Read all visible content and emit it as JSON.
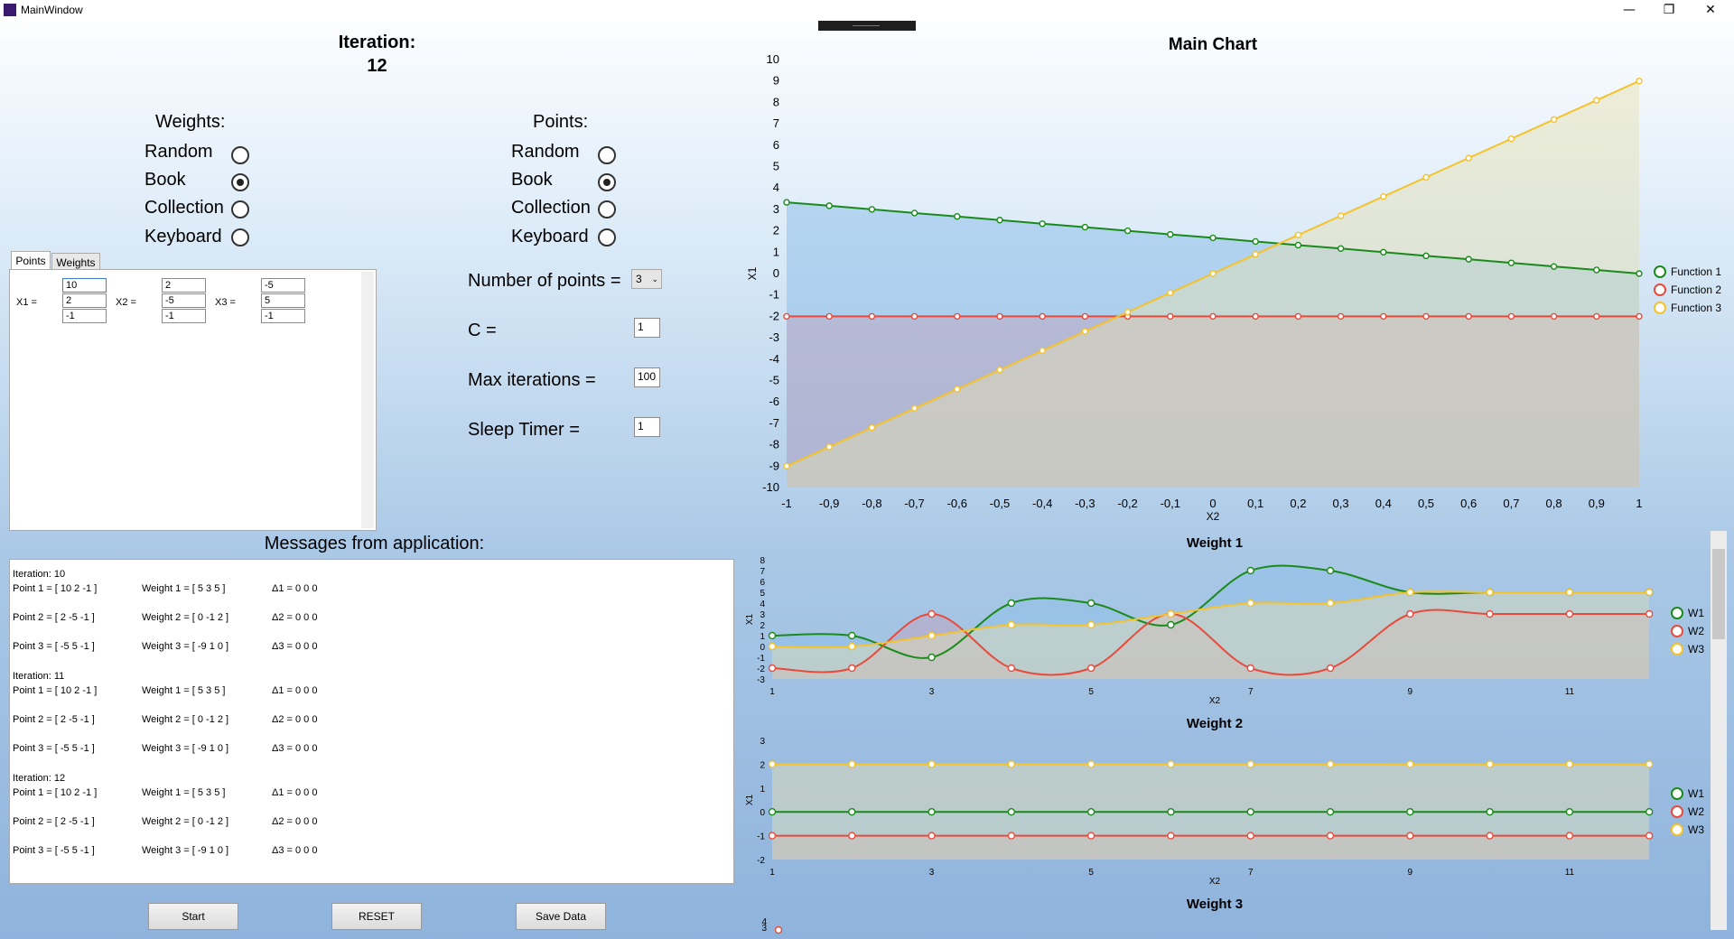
{
  "window": {
    "title": "MainWindow",
    "minimize": "—",
    "restore": "❐",
    "close": "✕"
  },
  "iteration": {
    "label": "Iteration:",
    "value": "12"
  },
  "weights_group": {
    "title": "Weights:",
    "options": [
      "Random",
      "Book",
      "Collection",
      "Keyboard"
    ],
    "selected": "Book"
  },
  "points_group": {
    "title": "Points:",
    "options": [
      "Random",
      "Book",
      "Collection",
      "Keyboard"
    ],
    "selected": "Book"
  },
  "tabs": [
    "Points",
    "Weights"
  ],
  "active_tab": "Points",
  "point_inputs": {
    "x1_label": "X1 =",
    "x2_label": "X2 =",
    "x3_label": "X3 =",
    "x1": [
      "10",
      "2",
      "-1"
    ],
    "x2": [
      "2",
      "-5",
      "-1"
    ],
    "x3": [
      "-5",
      "5",
      "-1"
    ]
  },
  "settings": {
    "num_points_label": "Number of points =",
    "num_points_value": "3",
    "c_label": "C =",
    "c_value": "1",
    "max_iter_label": "Max iterations =",
    "max_iter_value": "100",
    "sleep_label": "Sleep Timer =",
    "sleep_value": "1"
  },
  "messages_title": "Messages from application:",
  "messages": [
    {
      "iteration": "Iteration: 10",
      "rows": [
        [
          "Point 1 = [ 10 2 -1 ]",
          "Weight 1 = [ 5 3 5 ]",
          "Δ1 = 0 0 0"
        ],
        [
          "Point 2 = [ 2 -5 -1 ]",
          "Weight 2 = [ 0 -1 2 ]",
          "Δ2 = 0 0 0"
        ],
        [
          "Point 3 = [ -5 5 -1 ]",
          "Weight 3 = [ -9 1 0 ]",
          "Δ3 = 0 0 0"
        ]
      ]
    },
    {
      "iteration": "Iteration: 11",
      "rows": [
        [
          "Point 1 = [ 10 2 -1 ]",
          "Weight 1 = [ 5 3 5 ]",
          "Δ1 = 0 0 0"
        ],
        [
          "Point 2 = [ 2 -5 -1 ]",
          "Weight 2 = [ 0 -1 2 ]",
          "Δ2 = 0 0 0"
        ],
        [
          "Point 3 = [ -5 5 -1 ]",
          "Weight 3 = [ -9 1 0 ]",
          "Δ3 = 0 0 0"
        ]
      ]
    },
    {
      "iteration": "Iteration: 12",
      "rows": [
        [
          "Point 1 = [ 10 2 -1 ]",
          "Weight 1 = [ 5 3 5 ]",
          "Δ1 = 0 0 0"
        ],
        [
          "Point 2 = [ 2 -5 -1 ]",
          "Weight 2 = [ 0 -1 2 ]",
          "Δ2 = 0 0 0"
        ],
        [
          "Point 3 = [ -5 5 -1 ]",
          "Weight 3 = [ -9 1 0 ]",
          "Δ3 = 0 0 0"
        ]
      ]
    }
  ],
  "buttons": {
    "start": "Start",
    "reset": "RESET",
    "save": "Save Data"
  },
  "colors": {
    "green": "#1a8a1a",
    "red": "#e84a3c",
    "yellow": "#f6c229"
  },
  "chart_data": [
    {
      "type": "area",
      "title": "Main Chart",
      "xlabel": "X2",
      "ylabel": "X1",
      "xlim": [
        -1,
        1
      ],
      "ylim": [
        -10,
        10
      ],
      "x_ticks": [
        "-1",
        "-0,9",
        "-0,8",
        "-0,7",
        "-0,6",
        "-0,5",
        "-0,4",
        "-0,3",
        "-0,2",
        "-0,1",
        "0",
        "0,1",
        "0,2",
        "0,3",
        "0,4",
        "0,5",
        "0,6",
        "0,7",
        "0,8",
        "0,9",
        "1"
      ],
      "y_ticks": [
        "10",
        "9",
        "8",
        "7",
        "6",
        "5",
        "4",
        "3",
        "2",
        "1",
        "0",
        "-1",
        "-2",
        "-3",
        "-4",
        "-5",
        "-6",
        "-7",
        "-8",
        "-9",
        "-10"
      ],
      "x": [
        -1,
        -0.9,
        -0.8,
        -0.7,
        -0.6,
        -0.5,
        -0.4,
        -0.3,
        -0.2,
        -0.1,
        0,
        0.1,
        0.2,
        0.3,
        0.4,
        0.5,
        0.6,
        0.7,
        0.8,
        0.9,
        1
      ],
      "legend_position": "right",
      "series": [
        {
          "name": "Function 1",
          "color": "#1a8a1a",
          "values": [
            3.33,
            3.17,
            3.0,
            2.83,
            2.67,
            2.5,
            2.33,
            2.17,
            2.0,
            1.83,
            1.67,
            1.5,
            1.33,
            1.17,
            1.0,
            0.83,
            0.67,
            0.5,
            0.33,
            0.17,
            0
          ]
        },
        {
          "name": "Function 2",
          "color": "#e84a3c",
          "values": [
            -2,
            -2,
            -2,
            -2,
            -2,
            -2,
            -2,
            -2,
            -2,
            -2,
            -2,
            -2,
            -2,
            -2,
            -2,
            -2,
            -2,
            -2,
            -2,
            -2,
            -2
          ]
        },
        {
          "name": "Function 3",
          "color": "#f6c229",
          "values": [
            -9,
            -8.1,
            -7.2,
            -6.3,
            -5.4,
            -4.5,
            -3.6,
            -2.7,
            -1.8,
            -0.9,
            0,
            0.9,
            1.8,
            2.7,
            3.6,
            4.5,
            5.4,
            6.3,
            7.2,
            8.1,
            9
          ]
        }
      ]
    },
    {
      "type": "area",
      "title": "Weight 1",
      "xlabel": "X2",
      "ylabel": "X1",
      "xlim": [
        1,
        12.1
      ],
      "ylim": [
        -3,
        8
      ],
      "x_ticks": [
        "1",
        "3",
        "5",
        "7",
        "9",
        "11"
      ],
      "y_ticks": [
        "8",
        "7",
        "6",
        "5",
        "4",
        "3",
        "2",
        "1",
        "0",
        "-1",
        "-2",
        "-3"
      ],
      "x": [
        1,
        2,
        3,
        4,
        5,
        6,
        7,
        8,
        9,
        10,
        11,
        12
      ],
      "legend_position": "right",
      "series": [
        {
          "name": "W1",
          "color": "#1a8a1a",
          "values": [
            1,
            1,
            -1,
            4,
            4,
            2,
            7,
            7,
            5,
            5,
            5,
            5
          ]
        },
        {
          "name": "W2",
          "color": "#e84a3c",
          "values": [
            -2,
            -2,
            3,
            -2,
            -2,
            3,
            -2,
            -2,
            3,
            3,
            3,
            3
          ]
        },
        {
          "name": "W3",
          "color": "#f6c229",
          "values": [
            0,
            0,
            1,
            2,
            2,
            3,
            4,
            4,
            5,
            5,
            5,
            5
          ]
        }
      ]
    },
    {
      "type": "area",
      "title": "Weight 2",
      "xlabel": "X2",
      "ylabel": "X1",
      "xlim": [
        1,
        12.1
      ],
      "ylim": [
        -2,
        3
      ],
      "x_ticks": [
        "1",
        "3",
        "5",
        "7",
        "9",
        "11"
      ],
      "y_ticks": [
        "3",
        "2",
        "1",
        "0",
        "-1",
        "-2"
      ],
      "x": [
        1,
        2,
        3,
        4,
        5,
        6,
        7,
        8,
        9,
        10,
        11,
        12
      ],
      "legend_position": "right",
      "series": [
        {
          "name": "W1",
          "color": "#1a8a1a",
          "values": [
            0,
            0,
            0,
            0,
            0,
            0,
            0,
            0,
            0,
            0,
            0,
            0
          ]
        },
        {
          "name": "W2",
          "color": "#e84a3c",
          "values": [
            -1,
            -1,
            -1,
            -1,
            -1,
            -1,
            -1,
            -1,
            -1,
            -1,
            -1,
            -1
          ]
        },
        {
          "name": "W3",
          "color": "#f6c229",
          "values": [
            2,
            2,
            2,
            2,
            2,
            2,
            2,
            2,
            2,
            2,
            2,
            2
          ]
        }
      ]
    },
    {
      "type": "area",
      "title": "Weight 3",
      "y_ticks": [
        "4",
        "3"
      ]
    }
  ]
}
